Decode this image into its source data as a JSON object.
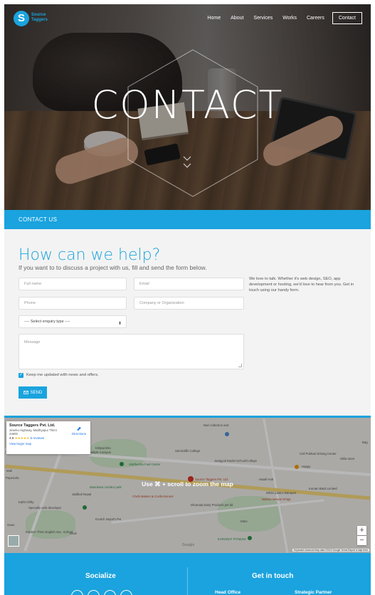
{
  "nav": {
    "logo_mark": "S",
    "logo_line1": "Source",
    "logo_line2": "Taggers",
    "links": [
      "Home",
      "About",
      "Services",
      "Works",
      "Careers"
    ],
    "cta": "Contact"
  },
  "hero": {
    "title": "CONTACT"
  },
  "banner": {
    "label": "CONTACT US"
  },
  "form_section": {
    "title": "How can we help?",
    "subtitle": "If you want to to discuss a project with us, fill and send the form below.",
    "side_text": "We love to talk. Whether it's web design, SEO, app development or hosting, we'd love to hear from you. Get in touch using our handy form.",
    "fields": {
      "full_name_placeholder": "Full name",
      "email_placeholder": "Email",
      "phone_placeholder": "Phone",
      "company_placeholder": "Company or Organization",
      "enquiry_selected": "---- Select enquiry type ----",
      "message_placeholder": "Message"
    },
    "checkbox_label": "Keep me updated with news and offers.",
    "checkbox_checked": true,
    "send_label": "SEND"
  },
  "map": {
    "scroll_message": "Use ⌘ + scroll to zoom the map",
    "info": {
      "name": "Source Taggers Pvt. Ltd.",
      "address": "Jiranko Highway, Madhyapur Thimi 44600",
      "rating": "4.5",
      "stars": "★★★★★",
      "reviews": "8 reviews",
      "view_larger": "View larger map",
      "directions": "Directions"
    },
    "labels": {
      "nari": "Nari collection and",
      "kirtipur": "Kirtipur/eko",
      "multiple": "Multiple Campus",
      "samriddhi": "Samriddhi College",
      "siddhartha": "Siddhartha Fuel Center",
      "jana": "Janajyoti Model School/College",
      "cellpoint": "Cell Pokhari Driving Center",
      "shila": "Shila store",
      "happy": "Happy",
      "manohara": "Manohara corridor park",
      "jadibuti": "Jadibuti Nepal",
      "source": "Source Taggers Pvt. Ltd.",
      "haadi": "Haadi Hub",
      "white_palace": "White palace Banquet",
      "nabina": "Nabina Newari Khaja",
      "kumari": "Kumari Bank Limited",
      "kathi": "Kathi Chilly",
      "specially": "Specially web developer",
      "chefs": "Chefs Bakers & Confectioners",
      "dhumala": "Dhumala Dairy Products pvt ltd",
      "krutich": "Krutich Nepal's Pvt",
      "kmu": "KMU",
      "karuna": "KARUNAY FITNESS",
      "pepsi": "Pepsicola",
      "kindern": "Kindern Thimi English Sec. School",
      "shall": "Shall",
      "gaun": "Gaun",
      "bag": "Bag",
      "mall": "Mall"
    },
    "zoom_in": "+",
    "zoom_out": "−",
    "google": "Google",
    "attribution": "Keyboard shortcuts   Map data ©2024 Google   Terms   Report a map error"
  },
  "footer": {
    "socialize": "Socialize",
    "get_in_touch": "Get in touch",
    "head_office": "Head Office",
    "strategic": "Strategic Partner"
  }
}
